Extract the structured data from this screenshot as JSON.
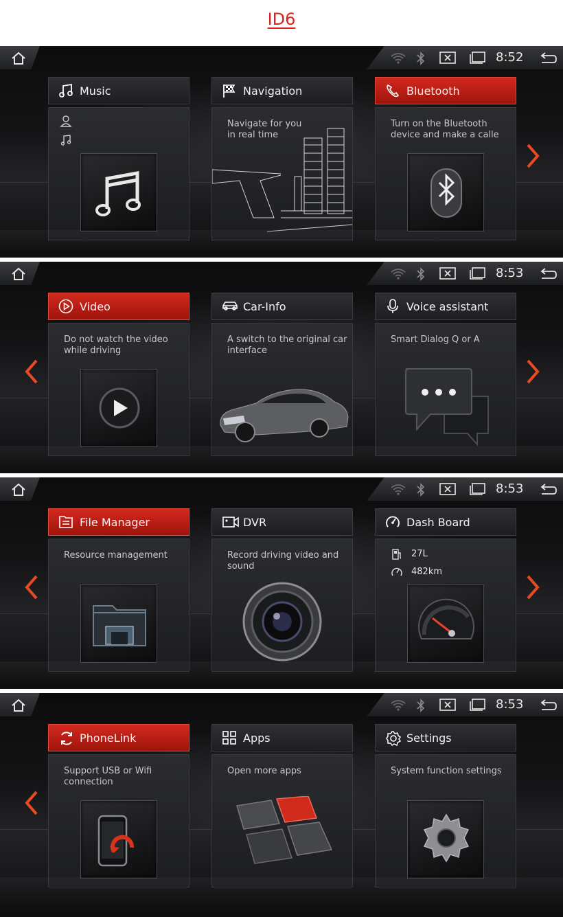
{
  "page_title": "ID6",
  "accent_color": "#d3291e",
  "screens": [
    {
      "time": "8:52",
      "cards": [
        {
          "label": "Music",
          "active": false,
          "description": ""
        },
        {
          "label": "Navigation",
          "active": false,
          "description": "Navigate for you in real time"
        },
        {
          "label": "Bluetooth",
          "active": true,
          "description": "Turn on the Bluetooth device and make a calle"
        }
      ]
    },
    {
      "time": "8:53",
      "cards": [
        {
          "label": "Video",
          "active": true,
          "description": "Do not watch the video while driving"
        },
        {
          "label": "Car-Info",
          "active": false,
          "description": "A switch to the original car interface"
        },
        {
          "label": "Voice assistant",
          "active": false,
          "description": "Smart Dialog Q or A"
        }
      ]
    },
    {
      "time": "8:53",
      "cards": [
        {
          "label": "File Manager",
          "active": true,
          "description": "Resource management"
        },
        {
          "label": "DVR",
          "active": false,
          "description": "Record driving video and sound"
        },
        {
          "label": "Dash Board",
          "active": false,
          "description": "",
          "fuel": "27L",
          "range": "482km"
        }
      ]
    },
    {
      "time": "8:53",
      "cards": [
        {
          "label": "PhoneLink",
          "active": true,
          "description": "Support USB or Wifi connection"
        },
        {
          "label": "Apps",
          "active": false,
          "description": "Open more apps"
        },
        {
          "label": "Settings",
          "active": false,
          "description": "System function settings"
        }
      ]
    }
  ],
  "icons": [
    "home-icon",
    "wifi-icon",
    "bluetooth-icon",
    "close-box-icon",
    "window-icon",
    "back-icon",
    "chevron-left-icon",
    "chevron-right-icon"
  ]
}
